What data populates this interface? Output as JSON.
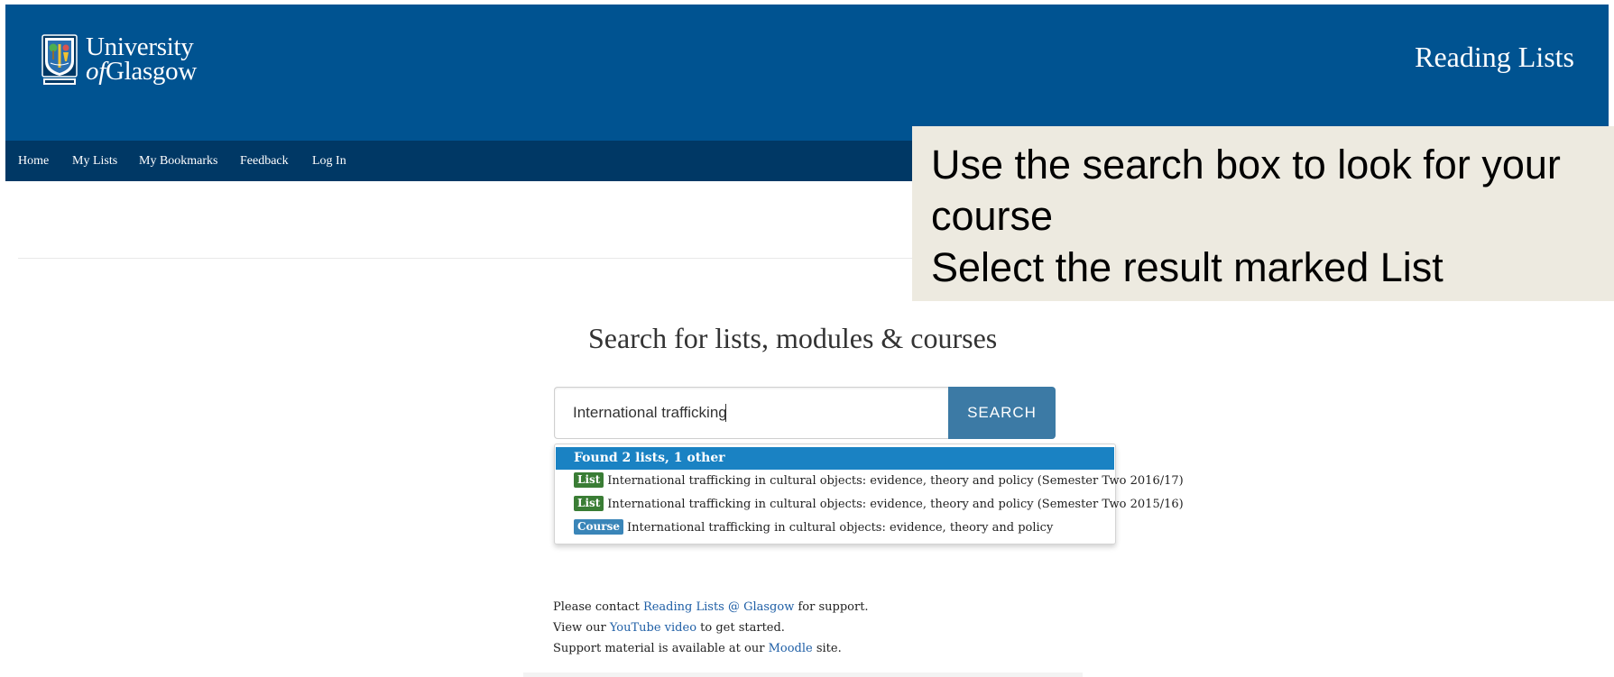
{
  "header": {
    "logo_line1": "University",
    "logo_line2_prefix": "of",
    "logo_line2_rest": "Glasgow",
    "site_title": "Reading Lists",
    "background_color": "#005391"
  },
  "nav": {
    "items": [
      "Home",
      "My Lists",
      "My Bookmarks",
      "Feedback",
      "Log In"
    ],
    "background_color": "#003865"
  },
  "callout": {
    "lines": [
      "Use the search box to look for your",
      "course",
      "Select the result marked List"
    ]
  },
  "search": {
    "heading": "Search for lists, modules & courses",
    "input_value": "International trafficking",
    "button_label": "SEARCH"
  },
  "results": {
    "header": "Found 2 lists, 1 other",
    "items": [
      {
        "tag": "List",
        "text": "International trafficking in cultural objects: evidence, theory and policy (Semester Two 2016/17)"
      },
      {
        "tag": "List",
        "text": "International trafficking in cultural objects: evidence, theory and policy (Semester Two 2015/16)"
      },
      {
        "tag": "Course",
        "text": "International trafficking in cultural objects: evidence, theory and policy"
      }
    ]
  },
  "support": {
    "line1_pre": "Please contact ",
    "line1_link": "Reading Lists @ Glasgow",
    "line1_post": " for support.",
    "line2_pre": "View our ",
    "line2_link": "YouTube video",
    "line2_post": " to get started.",
    "line3_pre": "Support material is available at our ",
    "line3_link": "Moodle",
    "line3_post": " site."
  },
  "colors": {
    "list_tag": "#3a7d35",
    "course_tag": "#3a85b8",
    "search_button": "#3c7aa5",
    "results_header": "#1a82c3",
    "callout_bg": "#edeae0"
  }
}
